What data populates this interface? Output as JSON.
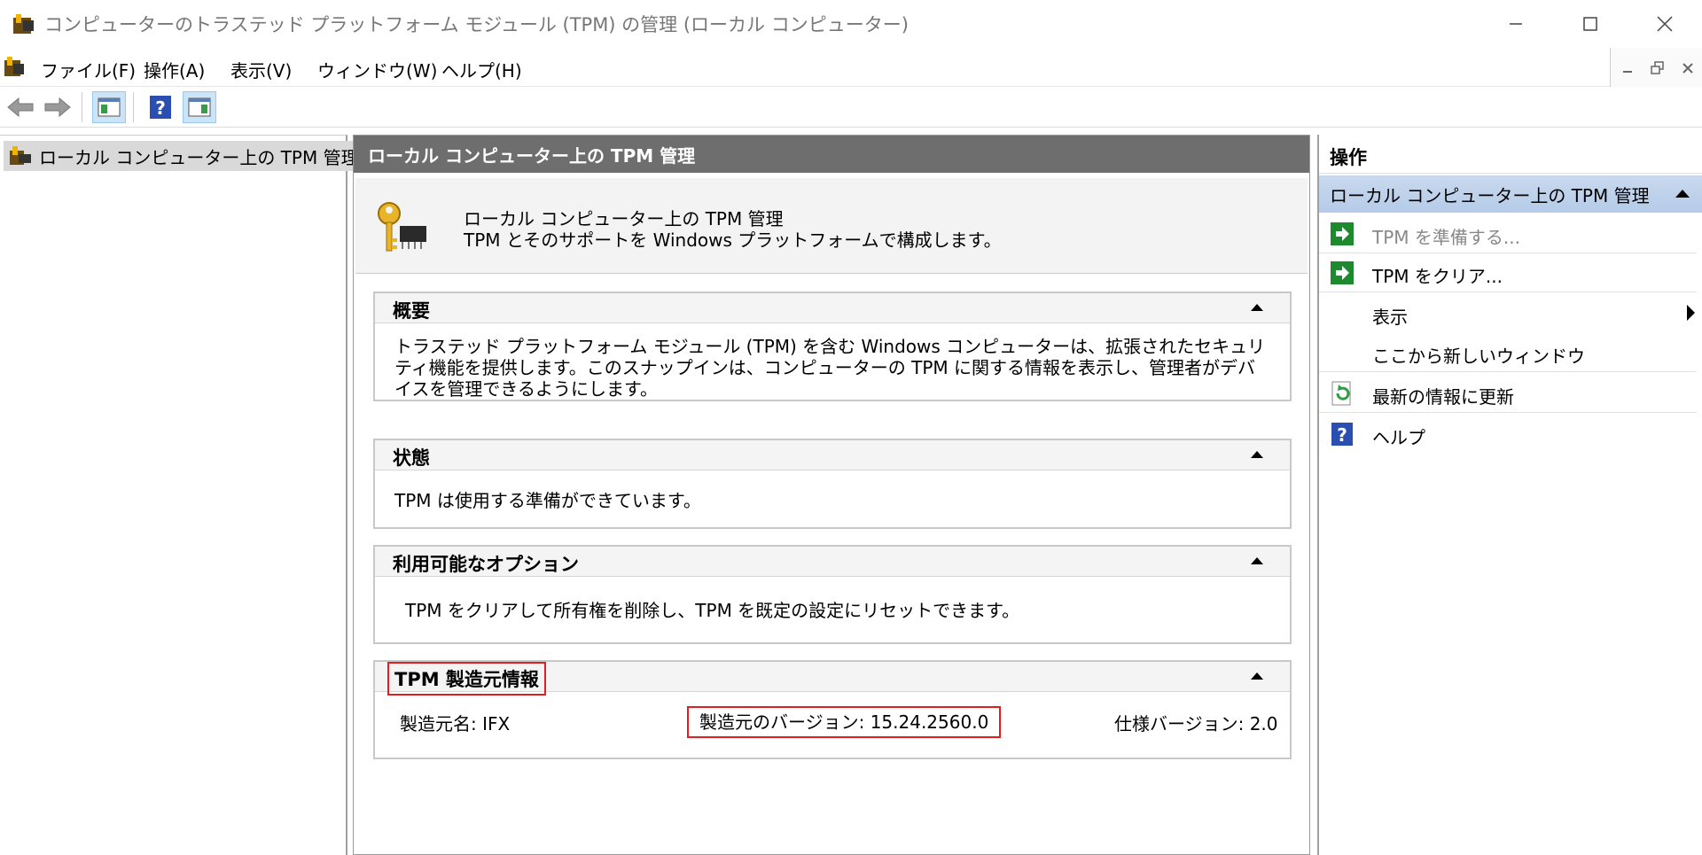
{
  "window": {
    "title": "コンピューターのトラステッド プラットフォーム モジュール (TPM) の管理 (ローカル コンピューター)"
  },
  "menu": [
    "ファイル(F)",
    "操作(A)",
    "表示(V)",
    "ウィンドウ(W)",
    "ヘルプ(H)"
  ],
  "tree": {
    "root_label": "ローカル コンピューター上の TPM 管理"
  },
  "center": {
    "header": "ローカル コンピューター上の TPM 管理",
    "intro_line1": "ローカル コンピューター上の TPM 管理",
    "intro_line2": "TPM とそのサポートを Windows プラットフォームで構成します。",
    "sections": {
      "overview": {
        "title": "概要",
        "body": "トラステッド プラットフォーム モジュール (TPM) を含む Windows コンピューターは、拡張されたセキュリティ機能を提供します。このスナップインは、コンピューターの TPM に関する情報を表示し、管理者がデバイスを管理できるようにします。"
      },
      "status": {
        "title": "状態",
        "body": "TPM は使用する準備ができています。"
      },
      "options": {
        "title": "利用可能なオプション",
        "body": "TPM をクリアして所有権を削除し、TPM を既定の設定にリセットできます。"
      },
      "manufacturer": {
        "title": "TPM 製造元情報",
        "name": "製造元名: IFX",
        "version": "製造元のバージョン: 15.24.2560.0",
        "spec": "仕様バージョン: 2.0"
      }
    }
  },
  "actions": {
    "header": "操作",
    "group": "ローカル コンピューター上の TPM 管理",
    "items": [
      {
        "label": "TPM を準備する...",
        "icon": "green-arrow-icon",
        "enabled": false
      },
      {
        "label": "TPM をクリア...",
        "icon": "green-arrow-icon",
        "enabled": true
      },
      {
        "label": "表示",
        "icon": "",
        "enabled": true
      },
      {
        "label": "ここから新しいウィンドウ",
        "icon": "",
        "enabled": true
      },
      {
        "label": "最新の情報に更新",
        "icon": "refresh-icon",
        "enabled": true
      },
      {
        "label": "ヘルプ",
        "icon": "help-icon",
        "enabled": true
      }
    ]
  },
  "colors": {
    "highlight_border": "#e02020",
    "header_bg": "#6e6e6e",
    "group_bg": "#c1d4ec",
    "action_icon_green": "#1e8a2e"
  }
}
